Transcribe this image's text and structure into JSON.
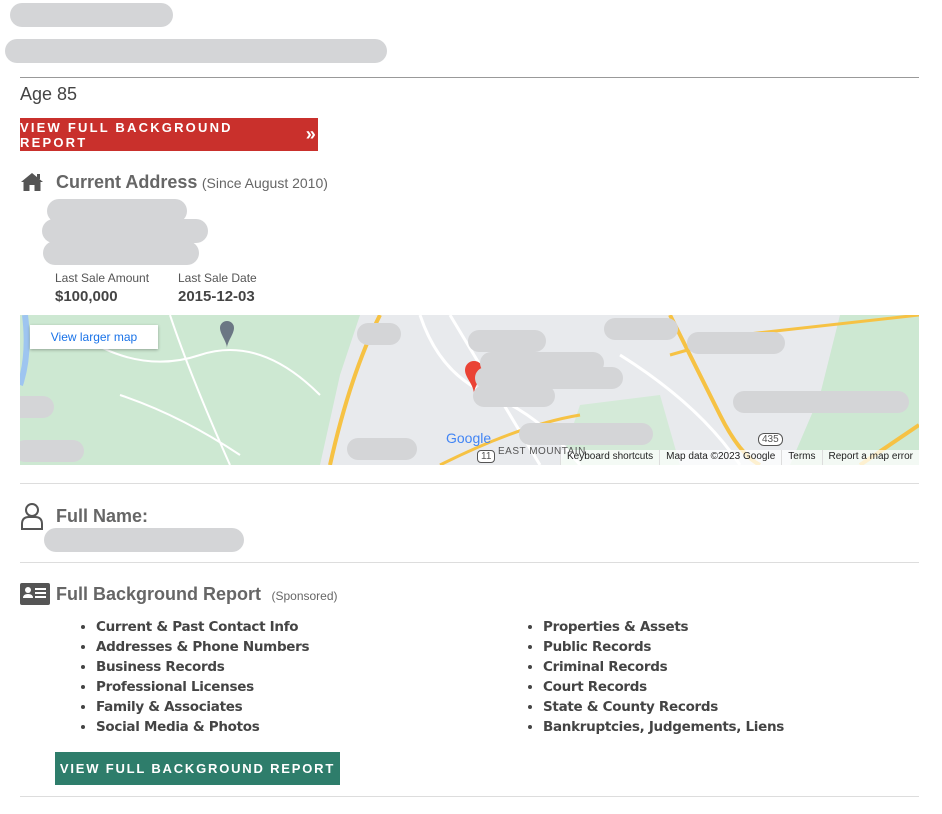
{
  "age": "Age 85",
  "cta_top": {
    "label": "VIEW FULL BACKGROUND REPORT",
    "icon": "double-chevron-right-icon"
  },
  "address": {
    "title": "Current Address",
    "since": "(Since August 2010)",
    "last_sale_amount_label": "Last Sale Amount",
    "last_sale_amount": "$100,000",
    "last_sale_date_label": "Last Sale Date",
    "last_sale_date": "2015-12-03"
  },
  "map": {
    "view_larger": "View larger map",
    "google_logo": "Google",
    "route_11": "11",
    "route_435": "435",
    "place_label": "EAST MOUNTAIN",
    "attribution": [
      "Keyboard shortcuts",
      "Map data ©2023 Google",
      "Terms",
      "Report a map error"
    ]
  },
  "full_name": {
    "title": "Full Name:"
  },
  "report": {
    "title": "Full Background Report",
    "sponsored": "(Sponsored)",
    "left_items": [
      "Current & Past Contact Info",
      "Addresses & Phone Numbers",
      "Business Records",
      "Professional Licenses",
      "Family & Associates",
      "Social Media & Photos"
    ],
    "right_items": [
      "Properties & Assets",
      "Public Records",
      "Criminal Records",
      "Court Records",
      "State & County Records",
      "Bankruptcies, Judgements, Liens"
    ],
    "cta_label": "VIEW FULL BACKGROUND REPORT"
  },
  "colors": {
    "red_cta": "#c9302c",
    "green_cta": "#2e7d6b"
  }
}
